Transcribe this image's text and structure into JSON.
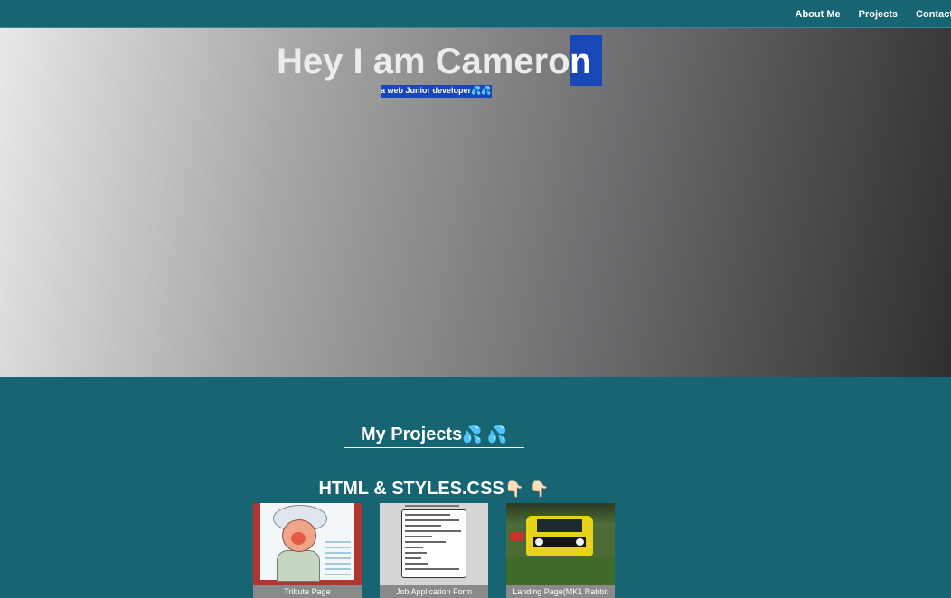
{
  "nav": {
    "links": [
      "About Me",
      "Projects",
      "Contact"
    ]
  },
  "hero": {
    "title": "Hey I am Camero",
    "title_selected_letter": "n",
    "subtitle": "a web Junior developer",
    "subtitle_emoji": "💦💦"
  },
  "projects": {
    "heading": "My Projects",
    "heading_emoji": "💦 💦",
    "section_heading": "HTML & STYLES.CSS",
    "section_emoji": "👇🏻 👇🏻",
    "cards": [
      {
        "caption": "Tribute Page",
        "thumb": "tribute-thumbnail"
      },
      {
        "caption": "Job Application Form",
        "thumb": "form-thumbnail"
      },
      {
        "caption": "Landing Page(MK1 Rabbit",
        "thumb": "car-thumbnail"
      }
    ]
  },
  "colors": {
    "nav_bg": "#176573",
    "page_bg": "#176573",
    "selection": "#1a47b8",
    "caption_bg": "#8a8a8a"
  }
}
